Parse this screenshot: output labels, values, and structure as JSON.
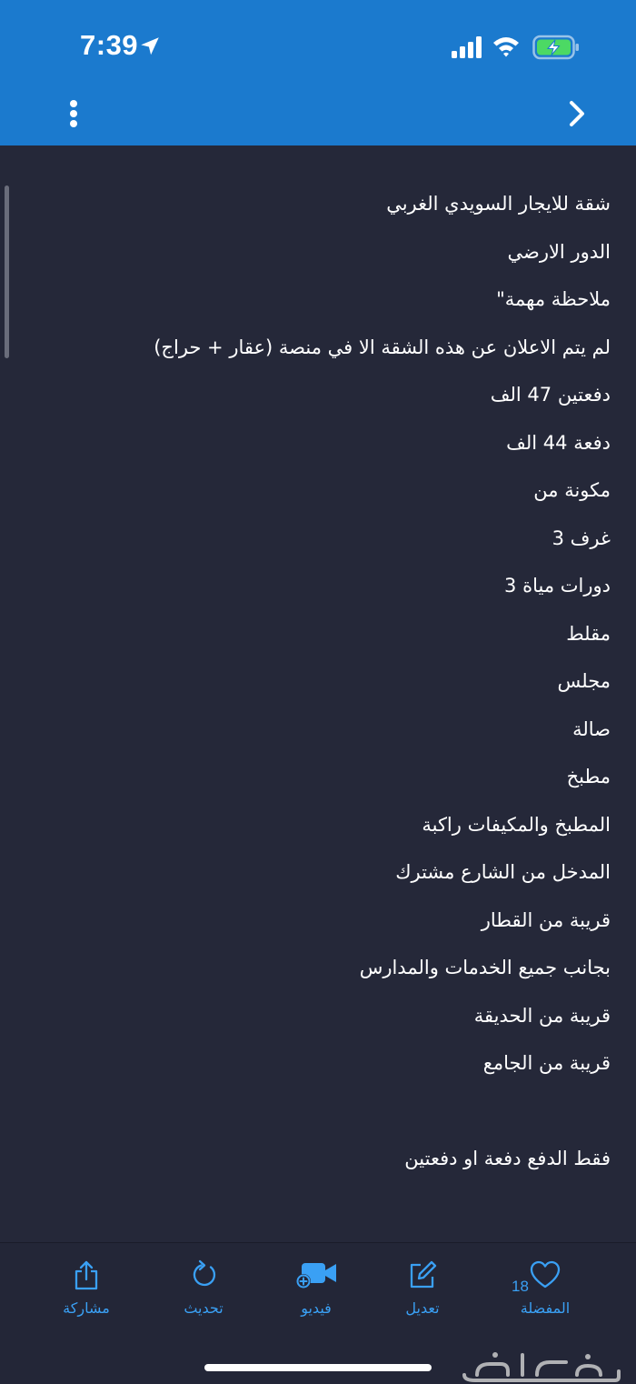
{
  "status_bar": {
    "time": "7:39",
    "location_icon": "location-arrow-icon",
    "signal_icon": "cellular-signal-icon",
    "wifi_icon": "wifi-icon",
    "battery_icon": "battery-charging-icon",
    "battery_color": "#4cd964"
  },
  "toolbar": {
    "menu_icon": "more-vertical-icon",
    "back_icon": "chevron-right-icon",
    "background_color": "#1b7ace"
  },
  "post": {
    "lines": [
      "شقة للايجار السويدي الغربي",
      "الدور الارضي",
      "ملاحظة مهمة\"",
      "لم يتم الاعلان عن هذه الشقة الا في منصة (عقار + حراج)",
      "دفعتين 47 الف",
      "دفعة 44 الف",
      "مكونة من",
      "غرف 3",
      "دورات مياة 3",
      "مقلط",
      "مجلس",
      "صالة",
      "مطبخ",
      "المطبخ والمكيفات راكبة",
      "المدخل من الشارع مشترك",
      "قريبة من القطار",
      "بجانب جميع الخدمات والمدارس",
      "قريبة من الحديقة",
      "قريبة من الجامع",
      "",
      "فقط الدفع دفعة او دفعتين"
    ]
  },
  "tabbar": {
    "accent_color": "#3aa0f4",
    "share": {
      "label": "مشاركة",
      "icon": "share-icon"
    },
    "refresh": {
      "label": "تحديث",
      "icon": "refresh-icon"
    },
    "video": {
      "label": "فيديو",
      "icon": "video-camera-add-icon"
    },
    "edit": {
      "label": "تعديل",
      "icon": "edit-icon"
    },
    "favorite": {
      "label": "المفضلة",
      "count": "18",
      "icon": "heart-icon"
    }
  },
  "watermark": {
    "text": "حراج",
    "icon": "haraj-logo"
  }
}
